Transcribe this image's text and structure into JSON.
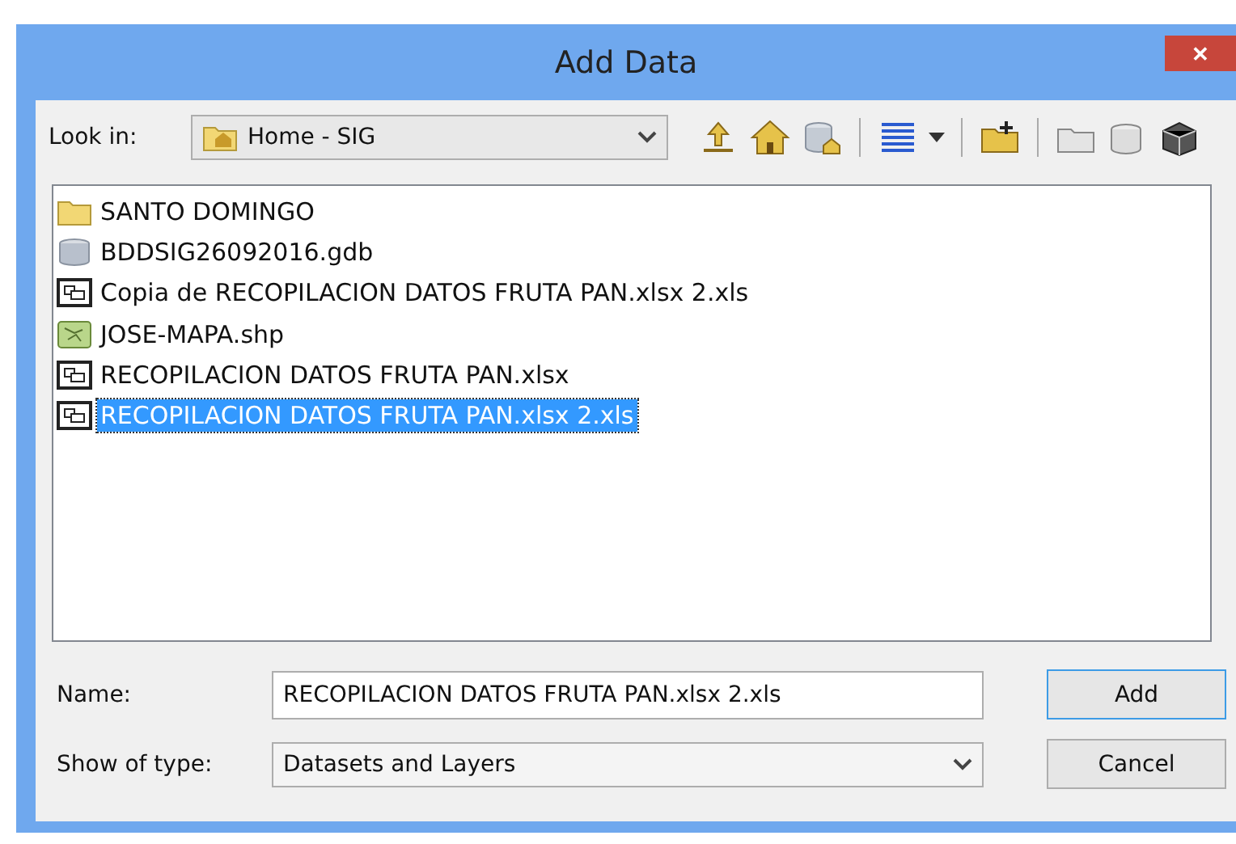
{
  "window": {
    "title": "Add Data",
    "close": "✕"
  },
  "look_in": {
    "label": "Look in:",
    "value": "Home - SIG"
  },
  "files": [
    {
      "name": "SANTO DOMINGO",
      "kind": "folder",
      "selected": false
    },
    {
      "name": "BDDSIG26092016.gdb",
      "kind": "database",
      "selected": false
    },
    {
      "name": "Copia de RECOPILACION DATOS FRUTA PAN.xlsx 2.xls",
      "kind": "table",
      "selected": false
    },
    {
      "name": "JOSE-MAPA.shp",
      "kind": "shapefile",
      "selected": false
    },
    {
      "name": "RECOPILACION DATOS FRUTA PAN.xlsx",
      "kind": "table",
      "selected": false
    },
    {
      "name": "RECOPILACION DATOS FRUTA PAN.xlsx 2.xls",
      "kind": "table",
      "selected": true
    }
  ],
  "name_field": {
    "label": "Name:",
    "value": "RECOPILACION DATOS FRUTA PAN.xlsx 2.xls"
  },
  "type_field": {
    "label": "Show of type:",
    "value": "Datasets and Layers"
  },
  "buttons": [
    {
      "label": "Add",
      "default": true
    },
    {
      "label": "Cancel",
      "default": false
    }
  ]
}
